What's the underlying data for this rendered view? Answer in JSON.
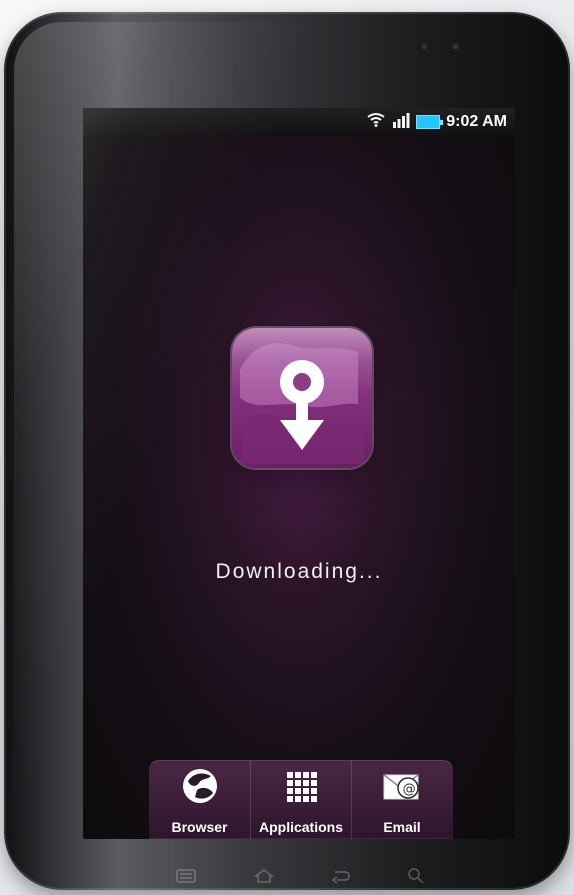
{
  "status_bar": {
    "time": "9:02 AM",
    "icons": [
      "wifi-icon",
      "signal-icon",
      "battery-icon"
    ]
  },
  "main": {
    "download_icon": "download-globe-icon",
    "status_text": "Downloading..."
  },
  "dock": {
    "items": [
      {
        "label": "Browser",
        "icon": "globe-icon"
      },
      {
        "label": "Applications",
        "icon": "grid-icon"
      },
      {
        "label": "Email",
        "icon": "email-icon"
      }
    ]
  },
  "nav_buttons": [
    "menu-icon",
    "home-icon",
    "back-icon",
    "search-icon"
  ],
  "colors": {
    "screen_accent": "#4a1d46",
    "app_icon": "#86317e",
    "battery": "#25c4ff"
  }
}
